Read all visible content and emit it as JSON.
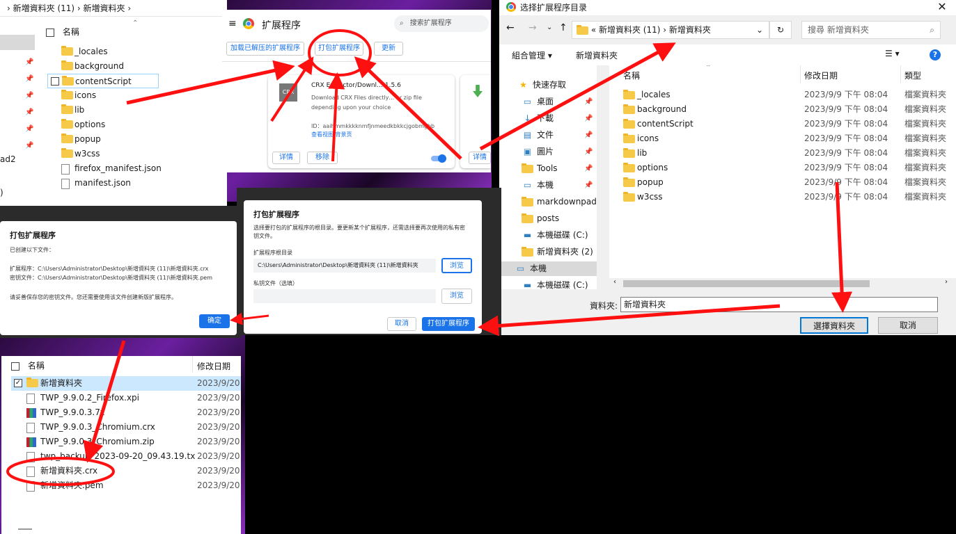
{
  "explorer_top": {
    "breadcrumb": [
      "新増資料夾 (11)",
      "新増資料夾"
    ],
    "col_name": "名稱",
    "items": [
      {
        "name": "_locales",
        "type": "folder"
      },
      {
        "name": "background",
        "type": "folder"
      },
      {
        "name": "contentScript",
        "type": "folder"
      },
      {
        "name": "icons",
        "type": "folder"
      },
      {
        "name": "lib",
        "type": "folder"
      },
      {
        "name": "options",
        "type": "folder"
      },
      {
        "name": "popup",
        "type": "folder"
      },
      {
        "name": "w3css",
        "type": "folder"
      },
      {
        "name": "firefox_manifest.json",
        "type": "file"
      },
      {
        "name": "manifest.json",
        "type": "file"
      }
    ],
    "left_partial": [
      "ad2",
      ")"
    ]
  },
  "extensions": {
    "title": "扩展程序",
    "search_placeholder": "搜索扩展程序",
    "load_unpacked": "加载已解压的扩展程序",
    "pack": "打包扩展程序",
    "update": "更新",
    "card": {
      "icon_text": "CRX",
      "name": "CRX Extractor/Downl… 1.5.6",
      "desc": "Download CRX Files directly… or zip file depending upon your choice",
      "id": "ID：aaihmmkkkknmfjnmeedkbkkcjgobmgbb",
      "inspect": "查看视图 背景页",
      "details": "详情",
      "remove": "移除"
    },
    "card2_details": "详情"
  },
  "pack_done": {
    "title": "打包扩展程序",
    "line1": "已创建以下文件：",
    "line2": "扩展程序：C:\\Users\\Administrator\\Desktop\\新增資料夾 (11)\\新增資料夾.crx",
    "line3": "密钥文件：C:\\Users\\Administrator\\Desktop\\新增資料夾 (11)\\新增資料夾.pem",
    "line4": "请妥善保存您的密钥文件。您还需要使用该文件创建新版扩展程序。",
    "ok": "确定"
  },
  "pack_dialog": {
    "title": "打包扩展程序",
    "desc": "选择要打包的扩展程序的根目录。要更新某个扩展程序，还需选择要再次使用的私有密钥文件。",
    "root_label": "扩展程序根目录",
    "root_value": "C:\\Users\\Administrator\\Desktop\\新增資料夾 (11)\\新增資料夾",
    "browse": "浏览",
    "key_label": "私钥文件（选填）",
    "browse2": "浏览",
    "cancel": "取消",
    "pack": "打包扩展程序"
  },
  "folder_picker": {
    "title": "选择扩展程序目录",
    "path": [
      "新增資料夾 (11)",
      "新增資料夾"
    ],
    "search_placeholder": "搜尋 新增資料夾",
    "organize": "組合管理",
    "new_folder": "新增資料夾",
    "columns": {
      "name": "名稱",
      "date": "修改日期",
      "type": "類型"
    },
    "nav": [
      {
        "label": "快速存取",
        "icon": "star-icon"
      },
      {
        "label": "桌面",
        "icon": "desktop-icon"
      },
      {
        "label": "下載",
        "icon": "download-icon"
      },
      {
        "label": "文件",
        "icon": "document-icon"
      },
      {
        "label": "圖片",
        "icon": "picture-icon"
      },
      {
        "label": "Tools",
        "icon": "folder-icon"
      },
      {
        "label": "本機",
        "icon": "monitor-icon"
      },
      {
        "label": "markdownpad2",
        "icon": "folder-icon"
      },
      {
        "label": "posts",
        "icon": "folder-icon"
      },
      {
        "label": "本機磁碟 (C:)",
        "icon": "drive-icon"
      },
      {
        "label": "新增資料夾 (2)",
        "icon": "folder-icon"
      },
      {
        "label": "本機",
        "icon": "computer-icon"
      },
      {
        "label": "本機磁碟 (C:)",
        "icon": "drive-icon"
      }
    ],
    "rows": [
      {
        "name": "_locales",
        "date": "2023/9/9 下午 08:04",
        "type": "檔案資料夾"
      },
      {
        "name": "background",
        "date": "2023/9/9 下午 08:04",
        "type": "檔案資料夾"
      },
      {
        "name": "contentScript",
        "date": "2023/9/9 下午 08:04",
        "type": "檔案資料夾"
      },
      {
        "name": "icons",
        "date": "2023/9/9 下午 08:04",
        "type": "檔案資料夾"
      },
      {
        "name": "lib",
        "date": "2023/9/9 下午 08:04",
        "type": "檔案資料夾"
      },
      {
        "name": "options",
        "date": "2023/9/9 下午 08:04",
        "type": "檔案資料夾"
      },
      {
        "name": "popup",
        "date": "2023/9/9 下午 08:04",
        "type": "檔案資料夾"
      },
      {
        "name": "w3css",
        "date": "2023/9/9 下午 08:04",
        "type": "檔案資料夾"
      }
    ],
    "folder_label": "資料夾:",
    "folder_value": "新增資料夾",
    "select": "選擇資料夾",
    "cancel": "取消"
  },
  "explorer_bottom": {
    "col_name": "名稱",
    "col_date": "修改日期",
    "rows": [
      {
        "name": "新增資料夾",
        "date": "2023/9/20",
        "type": "folder"
      },
      {
        "name": "TWP_9.9.0.2_Firefox.xpi",
        "date": "2023/9/20",
        "type": "file"
      },
      {
        "name": "TWP_9.9.0.3.7z",
        "date": "2023/9/20",
        "type": "zip"
      },
      {
        "name": "TWP_9.9.0.3_Chromium.crx",
        "date": "2023/9/20",
        "type": "file"
      },
      {
        "name": "TWP_9.9.0.3_Chromium.zip",
        "date": "2023/9/20",
        "type": "zip"
      },
      {
        "name": "twp_backup_2023-09-20_09.43.19.txt",
        "date": "2023/9/20",
        "type": "file"
      },
      {
        "name": "新增資料夾.crx",
        "date": "2023/9/20",
        "type": "file"
      },
      {
        "name": "新增資料夾.pem",
        "date": "2023/9/20",
        "type": "file"
      }
    ]
  },
  "annotation_color": "#ff1010"
}
